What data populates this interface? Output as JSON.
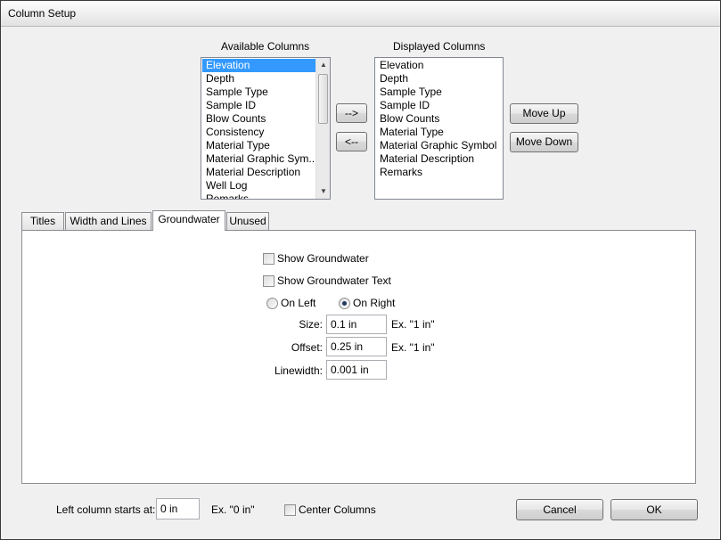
{
  "window": {
    "title": "Column Setup"
  },
  "available": {
    "label": "Available Columns",
    "items": [
      "Elevation",
      "Depth",
      "Sample Type",
      "Sample ID",
      "Blow Counts",
      "Consistency",
      "Material Type",
      "Material Graphic Sym...",
      "Material Description",
      "Well Log",
      "Remarks"
    ],
    "selected_index": 0
  },
  "displayed": {
    "label": "Displayed Columns",
    "items": [
      "Elevation",
      "Depth",
      "Sample Type",
      "Sample ID",
      "Blow Counts",
      "Material Type",
      "Material Graphic Symbol",
      "Material Description",
      "Remarks"
    ]
  },
  "buttons": {
    "add": "-->",
    "remove": "<--",
    "move_up": "Move Up",
    "move_down": "Move Down",
    "cancel": "Cancel",
    "ok": "OK"
  },
  "tabs": [
    "Titles",
    "Width and Lines",
    "Groundwater",
    "Unused"
  ],
  "active_tab": "Groundwater",
  "groundwater": {
    "show_groundwater": {
      "label": "Show Groundwater",
      "checked": false
    },
    "show_groundwater_text": {
      "label": "Show Groundwater Text",
      "checked": false
    },
    "position": {
      "left_label": "On Left",
      "right_label": "On Right",
      "selected": "On Right"
    },
    "size": {
      "label": "Size:",
      "value": "0.1 in",
      "hint": "Ex. \"1 in\""
    },
    "offset": {
      "label": "Offset:",
      "value": "0.25 in",
      "hint": "Ex. \"1 in\""
    },
    "linewidth": {
      "label": "Linewidth:",
      "value": "0.001 in"
    }
  },
  "footer": {
    "left_start_label": "Left column starts at:",
    "left_start_value": "0 in",
    "left_start_hint": "Ex. \"0 in\"",
    "center_columns": {
      "label": "Center Columns",
      "checked": false
    }
  }
}
